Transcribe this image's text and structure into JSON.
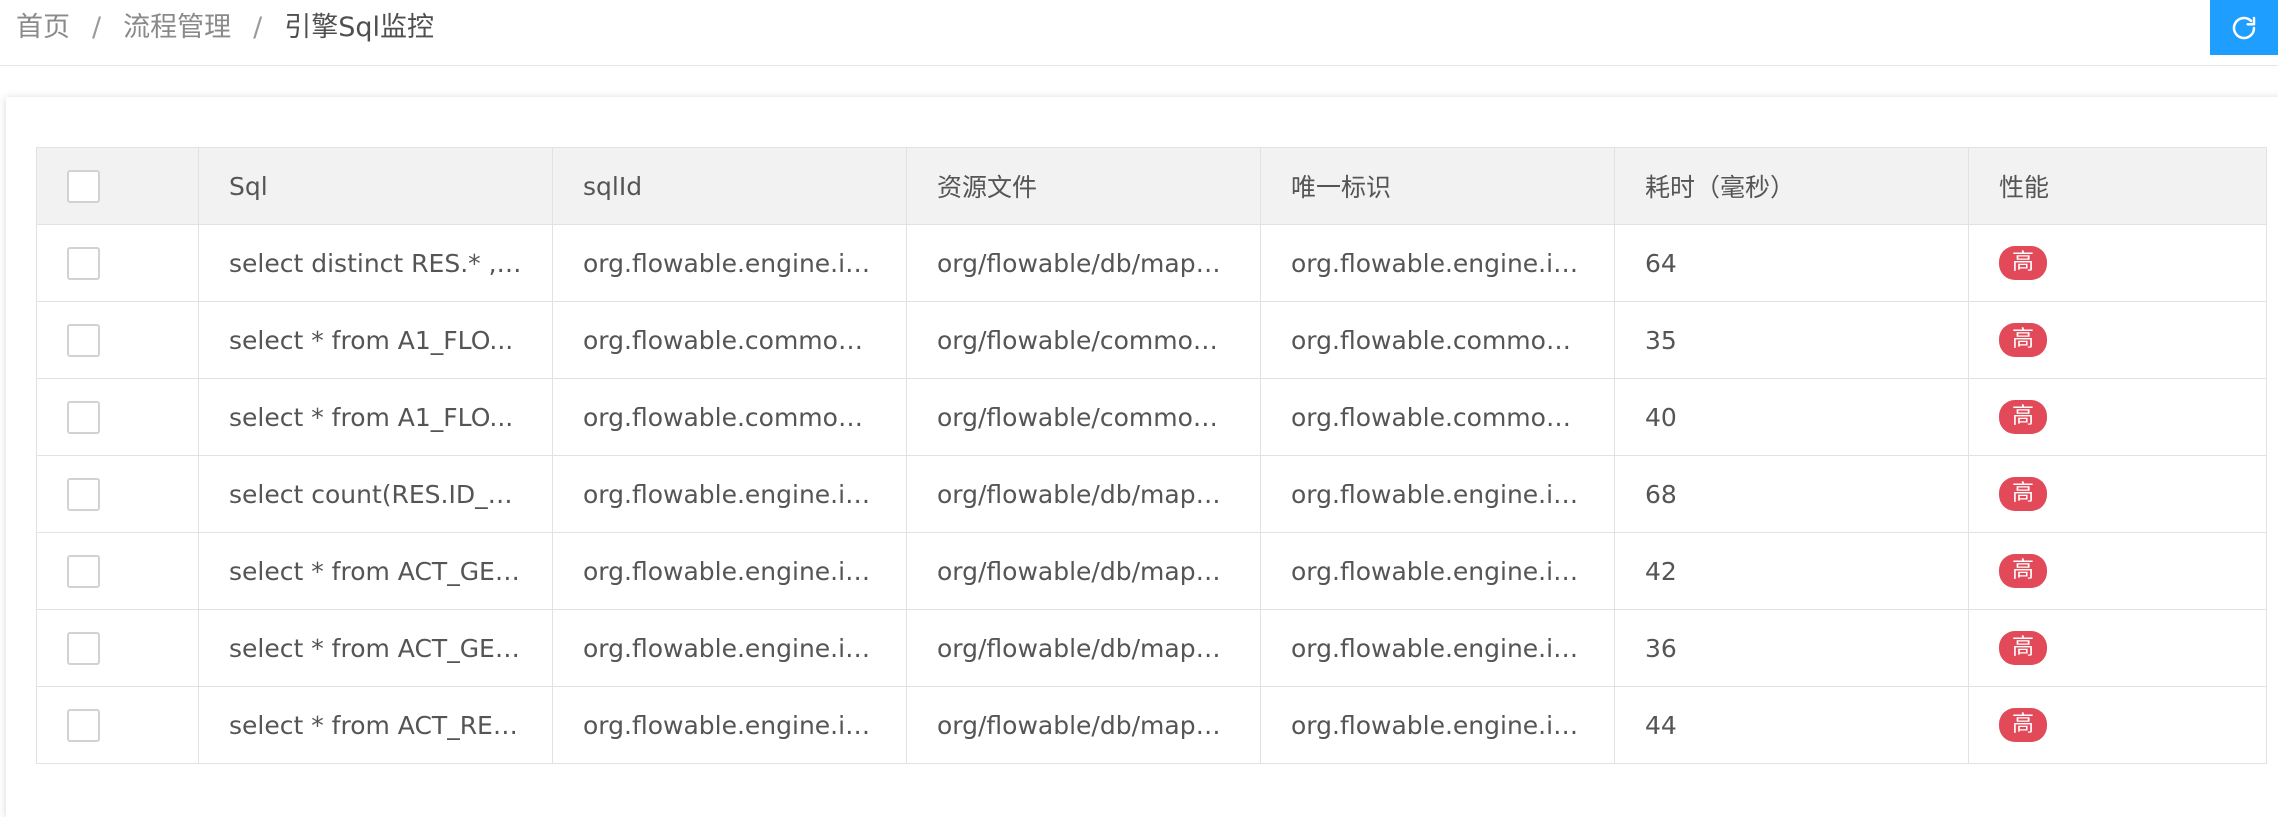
{
  "breadcrumb": {
    "items": [
      "首页",
      "流程管理",
      "引擎Sql监控"
    ],
    "separator": "/"
  },
  "toolbar": {
    "refresh_icon": "refresh-icon",
    "accent_color": "#1e9fff"
  },
  "table": {
    "headers": [
      "Sql",
      "sqlId",
      "资源文件",
      "唯一标识",
      "耗时（毫秒）",
      "性能"
    ],
    "badge_color": "#e24a5a",
    "rows": [
      {
        "sql": "select distinct RES.* , ...",
        "sqlId": "org.flowable.engine.im...",
        "resource": "org/flowable/db/mappi...",
        "uid": "org.flowable.engine.im...",
        "time": "64",
        "perf": "高"
      },
      {
        "sql": "select * from A1_FLO...",
        "sqlId": "org.flowable.common....",
        "resource": "org/flowable/common/...",
        "uid": "org.flowable.common....",
        "time": "35",
        "perf": "高"
      },
      {
        "sql": "select * from A1_FLO...",
        "sqlId": "org.flowable.common....",
        "resource": "org/flowable/common/...",
        "uid": "org.flowable.common....",
        "time": "40",
        "perf": "高"
      },
      {
        "sql": "select count(RES.ID_) ...",
        "sqlId": "org.flowable.engine.im...",
        "resource": "org/flowable/db/mappi...",
        "uid": "org.flowable.engine.im...",
        "time": "68",
        "perf": "高"
      },
      {
        "sql": "select * from ACT_GE_...",
        "sqlId": "org.flowable.engine.im...",
        "resource": "org/flowable/db/mappi...",
        "uid": "org.flowable.engine.im...",
        "time": "42",
        "perf": "高"
      },
      {
        "sql": "select * from ACT_GE_...",
        "sqlId": "org.flowable.engine.im...",
        "resource": "org/flowable/db/mappi...",
        "uid": "org.flowable.engine.im...",
        "time": "36",
        "perf": "高"
      },
      {
        "sql": "select * from ACT_RE_...",
        "sqlId": "org.flowable.engine.im...",
        "resource": "org/flowable/db/mappi...",
        "uid": "org.flowable.engine.im...",
        "time": "44",
        "perf": "高"
      }
    ]
  }
}
